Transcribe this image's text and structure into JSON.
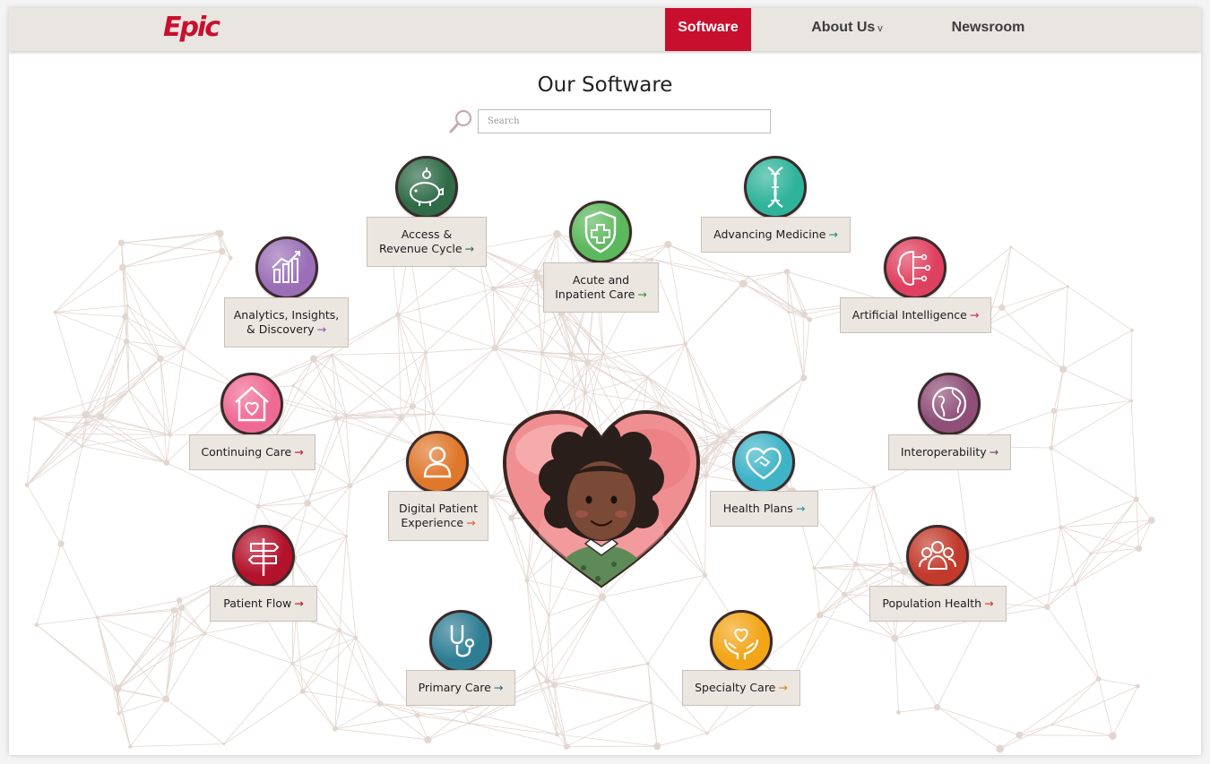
{
  "header": {
    "logo": "Epic",
    "nav": [
      {
        "label": "Software",
        "active": true
      },
      {
        "label": "About Us",
        "has_dropdown": true
      },
      {
        "label": "Newsroom"
      }
    ]
  },
  "page_title": "Our Software",
  "search": {
    "placeholder": "Search",
    "value": ""
  },
  "arrow": "→",
  "items": [
    {
      "label_line1": "Access &",
      "label_line2": "Revenue Cycle",
      "icon": "piggy-bank-icon",
      "color": "#2f6b47",
      "arrow_color": "#2f6b47"
    },
    {
      "label_line1": "Advancing Medicine",
      "label_line2": "",
      "icon": "dna-icon",
      "color": "#2fb39a",
      "arrow_color": "#1b8a76"
    },
    {
      "label_line1": "Acute and",
      "label_line2": "Inpatient Care",
      "icon": "shield-cross-icon",
      "color": "#5cb85c",
      "arrow_color": "#3e8e3e"
    },
    {
      "label_line1": "Analytics, Insights,",
      "label_line2": "& Discovery",
      "icon": "chart-icon",
      "color": "#9b6fb8",
      "arrow_color": "#8a5aa8"
    },
    {
      "label_line1": "Artificial Intelligence",
      "label_line2": "",
      "icon": "brain-circuit-icon",
      "color": "#e0405f",
      "arrow_color": "#d02a48"
    },
    {
      "label_line1": "Continuing Care",
      "label_line2": "",
      "icon": "house-heart-icon",
      "color": "#ef6a93",
      "arrow_color": "#c8102e"
    },
    {
      "label_line1": "Interoperability",
      "label_line2": "",
      "icon": "globe-icon",
      "color": "#8f4f78",
      "arrow_color": "#7a3e66"
    },
    {
      "label_line1": "Digital Patient",
      "label_line2": "Experience",
      "icon": "person-icon",
      "color": "#e0782c",
      "arrow_color": "#d85f1c"
    },
    {
      "label_line1": "Health Plans",
      "label_line2": "",
      "icon": "handshake-heart-icon",
      "color": "#3fb3c7",
      "arrow_color": "#268ca0"
    },
    {
      "label_line1": "Patient Flow",
      "label_line2": "",
      "icon": "signpost-icon",
      "color": "#b3122b",
      "arrow_color": "#b3122b"
    },
    {
      "label_line1": "Population Health",
      "label_line2": "",
      "icon": "people-group-icon",
      "color": "#c23a2c",
      "arrow_color": "#c23a2c"
    },
    {
      "label_line1": "Primary Care",
      "label_line2": "",
      "icon": "stethoscope-icon",
      "color": "#2e7e93",
      "arrow_color": "#2e6f80"
    },
    {
      "label_line1": "Specialty Care",
      "label_line2": "",
      "icon": "hands-heart-icon",
      "color": "#f2a516",
      "arrow_color": "#d9830b"
    }
  ]
}
